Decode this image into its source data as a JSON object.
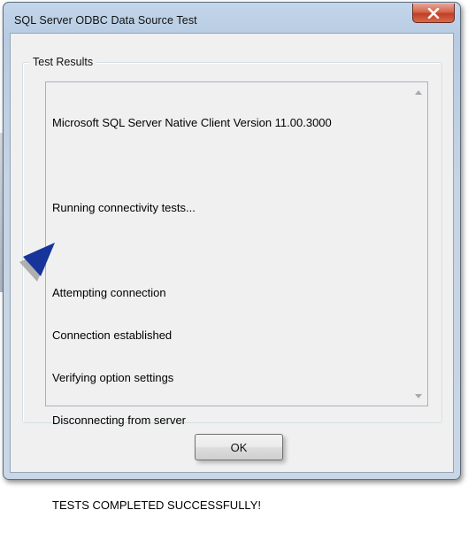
{
  "window": {
    "title": "SQL Server ODBC Data Source Test",
    "close_icon": "close-icon"
  },
  "group": {
    "label": "Test Results"
  },
  "results": {
    "lines": [
      "Microsoft SQL Server Native Client Version 11.00.3000",
      "",
      "Running connectivity tests...",
      "",
      "Attempting connection",
      "Connection established",
      "Verifying option settings",
      "Disconnecting from server",
      "",
      "TESTS COMPLETED SUCCESSFULLY!"
    ],
    "scroll_up_icon": "scroll-up-arrow-icon",
    "scroll_down_icon": "scroll-down-arrow-icon"
  },
  "buttons": {
    "ok_label": "OK"
  },
  "annotation": {
    "icon": "pointer-arrow-icon",
    "color": "#16349a"
  },
  "colors": {
    "close_button": "#c23e22",
    "dialog_background": "#f0f0f0",
    "frame": "#b7cbe2"
  }
}
